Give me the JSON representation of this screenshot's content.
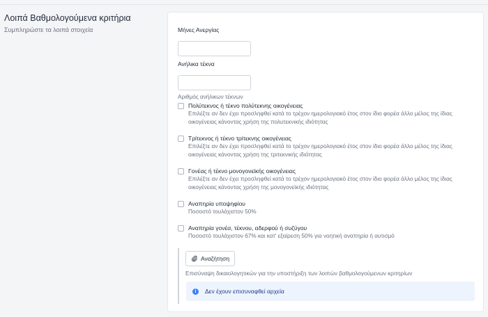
{
  "section": {
    "title": "Λοιπά Βαθμολογούμενα κριτήρια",
    "subtitle": "Συμπληρώστε τα λοιπά στοιχεία"
  },
  "fields": {
    "unemployment_months": {
      "label": "Μήνες Ανεργίας",
      "value": ""
    },
    "minor_children": {
      "label": "Ανήλικα τέκνα",
      "value": "",
      "help": "Αριθμός ανήλικων τέκνων"
    }
  },
  "checkboxes": [
    {
      "label": "Πολύτεκνος ή τέκνο πολύτεκνης οικογένειας",
      "desc_line1": "Επιλέξτε αν δεν έχει προσληφθεί κατά το τρέχον ημερολογιακό έτος στον ίδιο φορέα άλλο μέλος της ίδιας",
      "desc_line2": "οικογένειας κάνοντας χρήση της πολυτεκνικής ιδιότητας",
      "checked": false
    },
    {
      "label": "Τρίτεκνος ή τέκνο τρίτεκνης οικογένειας",
      "desc_line1": "Επιλέξτε αν δεν έχει προσληφθεί κατά το τρέχον ημερολογιακό έτος στον ίδιο φορέα άλλο μέλος της ίδιας",
      "desc_line2": "οικογένειας κάνοντας χρήση της τριτεκνικής ιδιότητας",
      "checked": false
    },
    {
      "label": "Γονέας ή τέκνο μονογονεϊκής οικογένειας",
      "desc_line1": "Επιλέξτε αν δεν έχει προσληφθεί κατά το τρέχον ημερολογιακό έτος στον ίδιο φορέα άλλο μέλος της ίδιας",
      "desc_line2": "οικογένειας κάνοντας χρήση της μονογονεϊκής ιδιότητας",
      "checked": false
    },
    {
      "label": "Αναπηρία υποψηφίου",
      "desc_line1": "Ποσοστό τουλάχιστον 50%",
      "checked": false
    },
    {
      "label": "Αναπηρία γονέα, τέκνου, αδερφού ή συζύγου",
      "desc_line1": "Ποσοστό τουλάχιστον 67% και κατ' εξαίρεση 50% για νοητική αναπηρία ή αυτισμό",
      "checked": false
    }
  ],
  "upload": {
    "button_label": "Αναζήτηση",
    "help": "Επισύναψη δικαιολογητικών για την υποστήριξη των λοιπών βαθμολογούμενων κριτηρίων",
    "empty_message": "Δεν έχουν επισυναφθεί αρχεία"
  },
  "icons": {
    "upload_icon": "paperclip-icon",
    "alert_icon": "info-icon"
  },
  "colors": {
    "info_accent": "#3b82f6",
    "info_background": "#eef4fd"
  }
}
